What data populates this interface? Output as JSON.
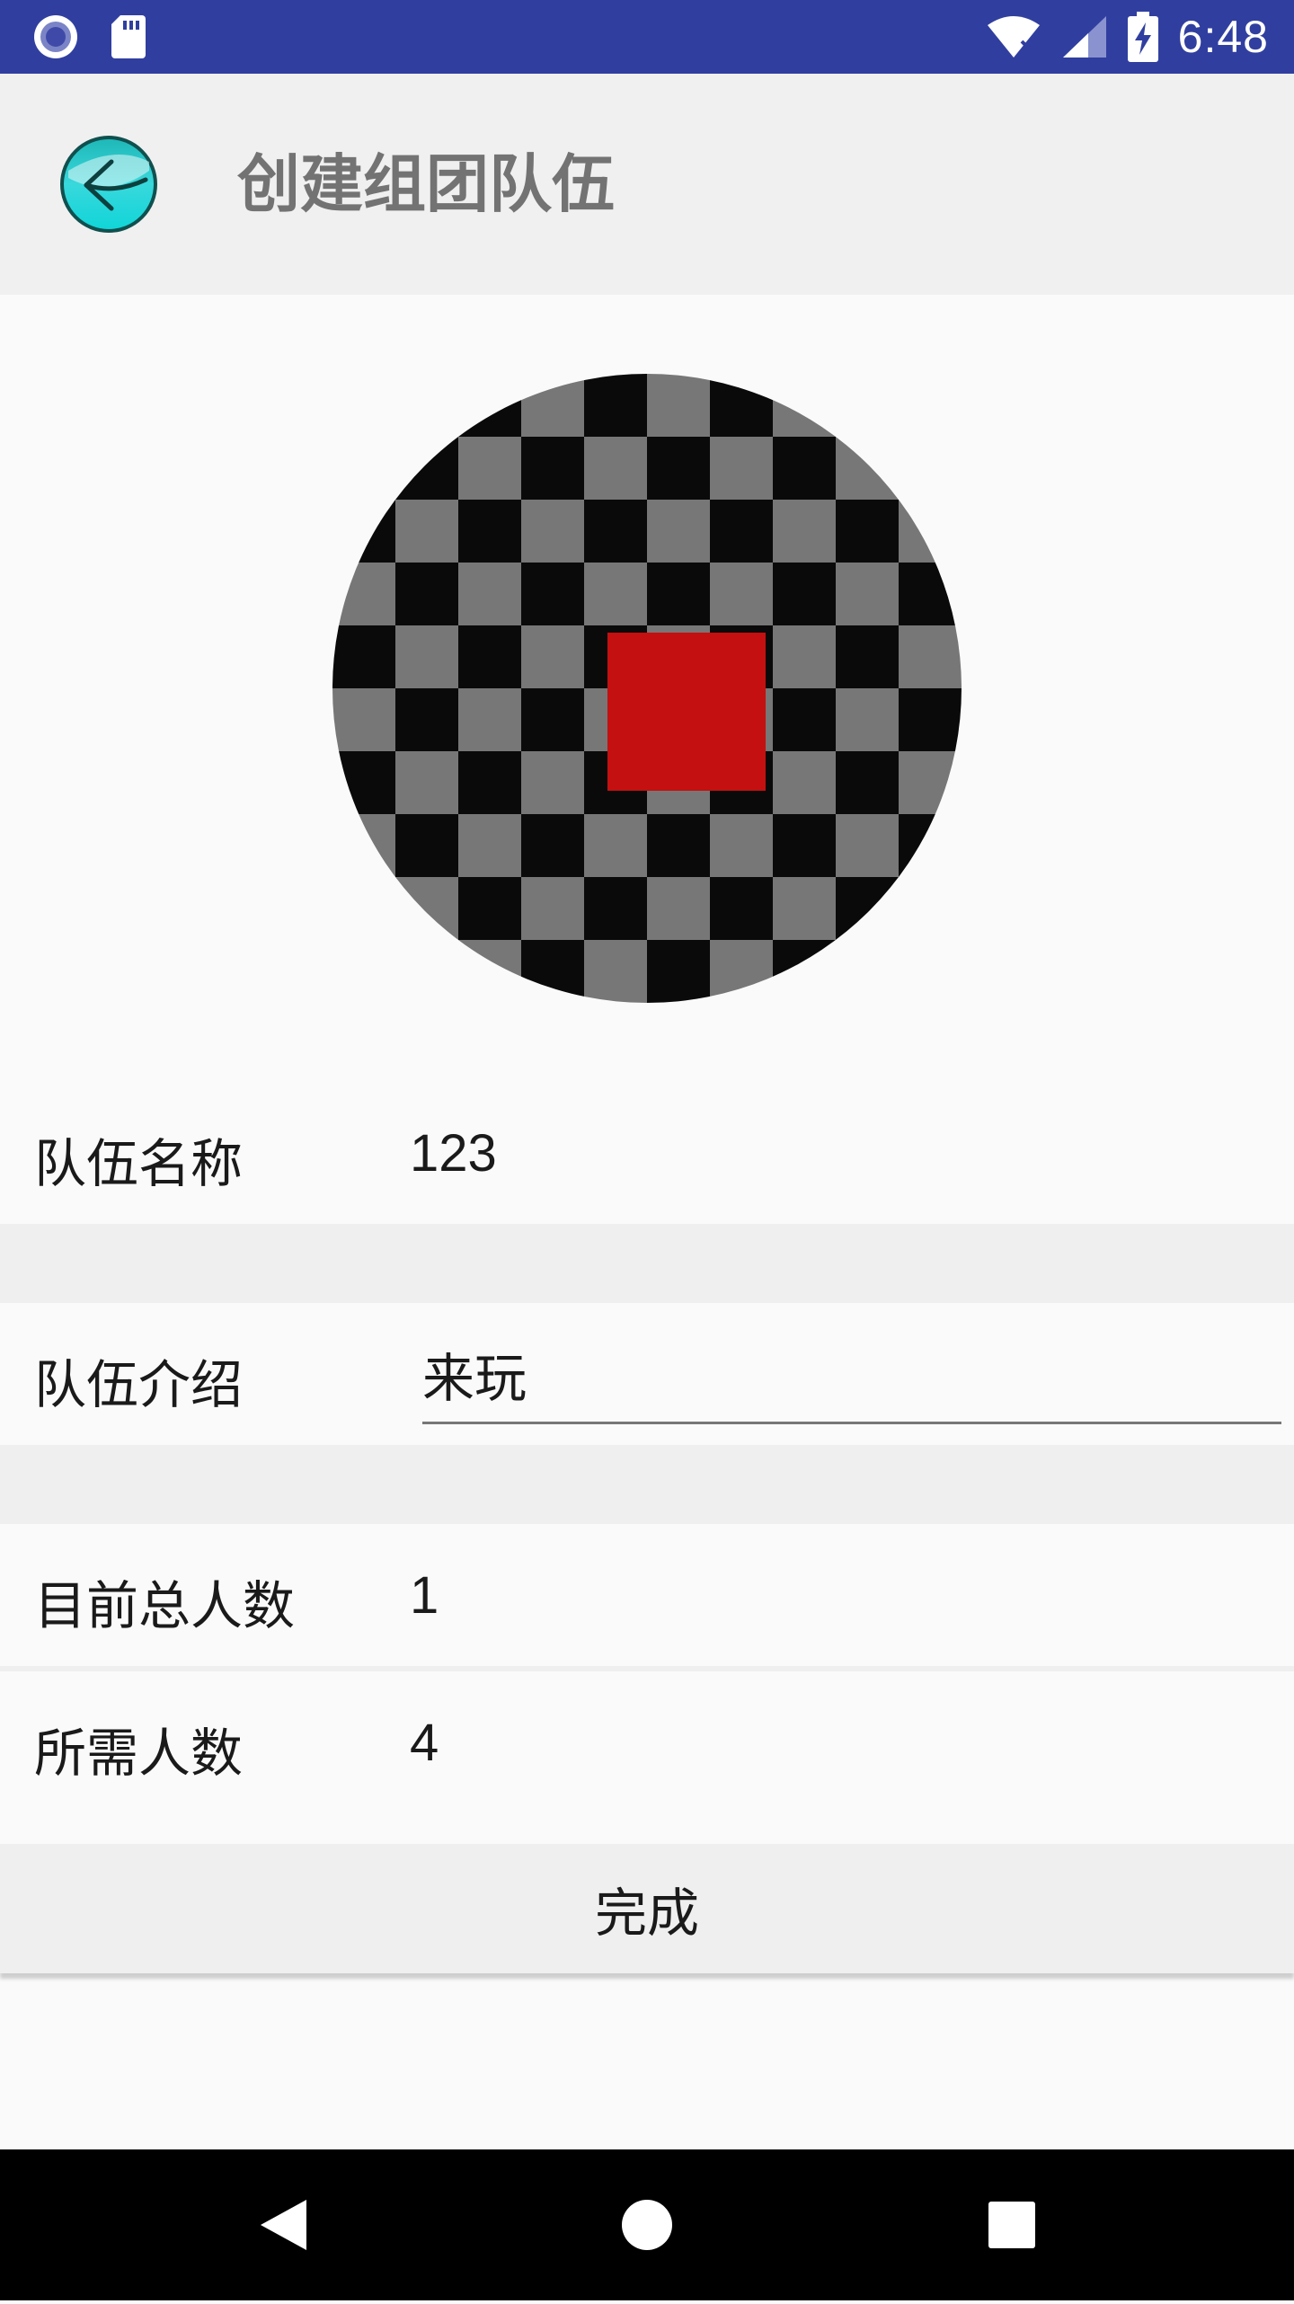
{
  "status_bar": {
    "time": "6:48",
    "icons": [
      "notification-circle-icon",
      "sd-card-icon",
      "wifi-icon",
      "signal-icon",
      "battery-charging-icon"
    ],
    "color": "#303f9f"
  },
  "toolbar": {
    "title": "创建组团队伍",
    "back_icon": "back-arrow-icon"
  },
  "avatar": {
    "description_icon": "team-avatar-image"
  },
  "form": {
    "team_name": {
      "label": "队伍名称",
      "value": "123"
    },
    "team_intro": {
      "label": "队伍介绍",
      "value": "来玩"
    },
    "current_total": {
      "label": "目前总人数",
      "value": "1"
    },
    "required_count": {
      "label": "所需人数",
      "value": "4"
    }
  },
  "actions": {
    "done_label": "完成"
  },
  "nav_bar": {
    "buttons": [
      "back-triangle-icon",
      "home-circle-icon",
      "recents-square-icon"
    ]
  }
}
